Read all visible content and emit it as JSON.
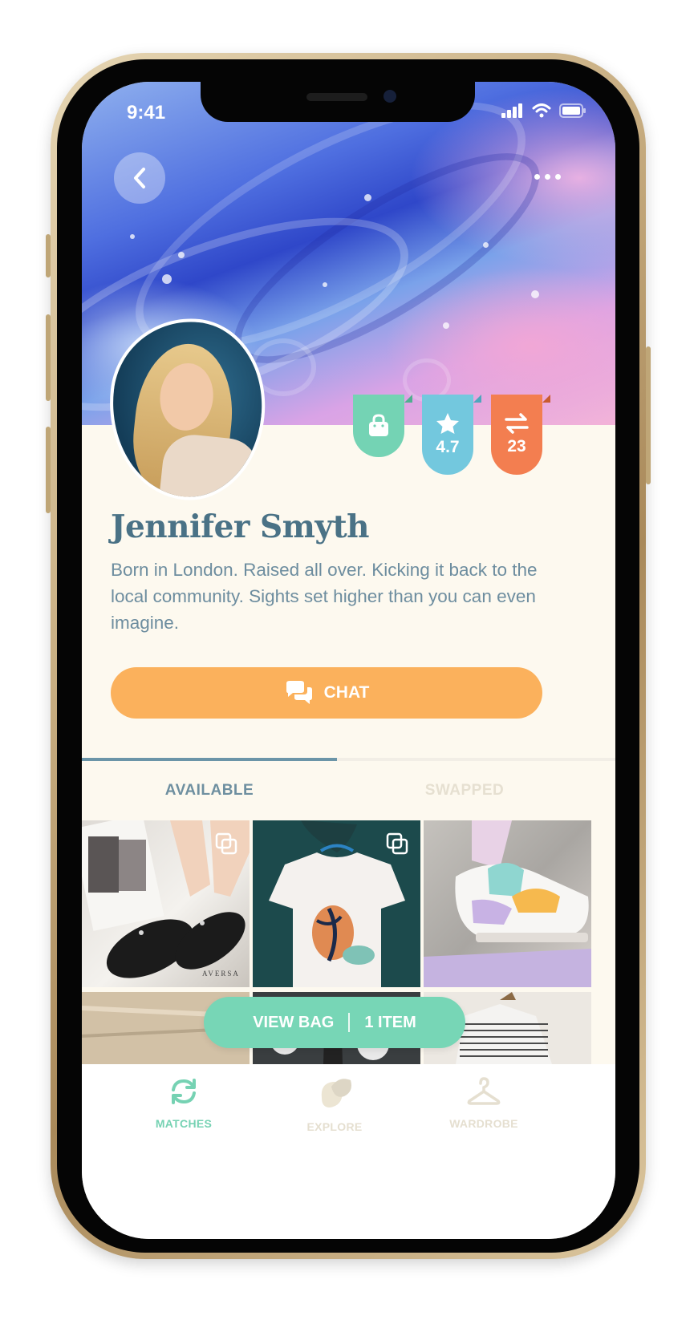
{
  "status_bar": {
    "time": "9:41"
  },
  "profile": {
    "name": "Jennifer Smyth",
    "bio": "Born in London. Raised all over. Kicking it back to the local community. Sights set higher than you can even imagine.",
    "rating": "4.7",
    "swaps": "23",
    "chat_label": "CHAT"
  },
  "tabs": [
    {
      "label": "AVAILABLE",
      "active": true
    },
    {
      "label": "SWAPPED",
      "active": false
    }
  ],
  "bag": {
    "label": "VIEW BAG",
    "count": "1 ITEM"
  },
  "nav": [
    {
      "label": "MATCHES",
      "icon": "refresh-icon",
      "active": true
    },
    {
      "label": "EXPLORE",
      "icon": "blob-icon",
      "active": false
    },
    {
      "label": "WARDROBE",
      "icon": "hanger-icon",
      "active": false
    }
  ],
  "grid": {
    "aversa_text": "AVERSA"
  },
  "colors": {
    "accent_green": "#76d2b3",
    "accent_orange": "#fbb15c",
    "badge_blue": "#73c8de",
    "badge_coral": "#f37e50",
    "text_blue": "#4a7286",
    "background": "#fdf9ef"
  }
}
